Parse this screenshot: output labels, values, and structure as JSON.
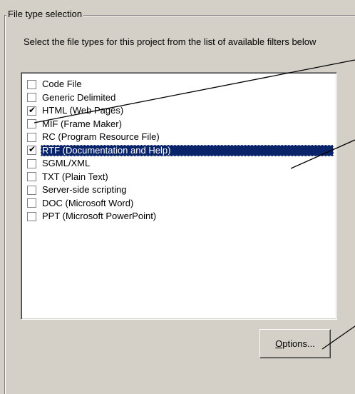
{
  "group": {
    "legend": "File type selection",
    "instructions": "Select the file types for this project from the list of available filters below"
  },
  "file_types": [
    {
      "label": "Code File",
      "checked": false,
      "selected": false
    },
    {
      "label": "Generic Delimited",
      "checked": false,
      "selected": false
    },
    {
      "label": "HTML (Web Pages)",
      "checked": true,
      "selected": false
    },
    {
      "label": "MIF (Frame Maker)",
      "checked": false,
      "selected": false
    },
    {
      "label": "RC (Program Resource File)",
      "checked": false,
      "selected": false
    },
    {
      "label": "RTF (Documentation and Help)",
      "checked": true,
      "selected": true
    },
    {
      "label": "SGML/XML",
      "checked": false,
      "selected": false
    },
    {
      "label": "TXT (Plain Text)",
      "checked": false,
      "selected": false
    },
    {
      "label": "Server-side scripting",
      "checked": false,
      "selected": false
    },
    {
      "label": "DOC (Microsoft Word)",
      "checked": false,
      "selected": false
    },
    {
      "label": "PPT (Microsoft PowerPoint)",
      "checked": false,
      "selected": false
    }
  ],
  "options_button": {
    "accel": "O",
    "rest": "ptions..."
  },
  "colors": {
    "face": "#d4d0c8",
    "selection": "#0a246a"
  }
}
